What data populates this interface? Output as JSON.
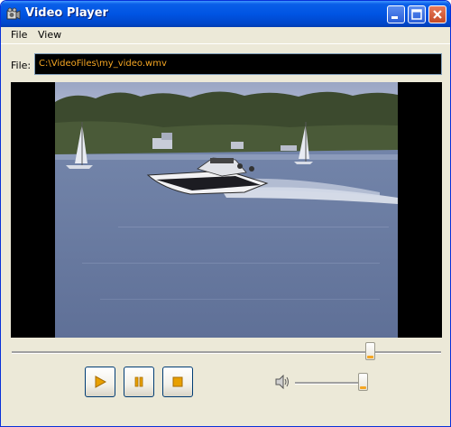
{
  "window": {
    "title": "Video Player"
  },
  "menu": {
    "items": [
      "File",
      "View"
    ]
  },
  "file": {
    "label": "File:",
    "path": "C:\\VideoFiles\\my_video.wmv"
  },
  "playback": {
    "position_fraction": 0.86
  },
  "volume": {
    "level_fraction": 0.95
  },
  "colors": {
    "titlebar": "#0054e3",
    "path_text": "#f5a623",
    "accent": "#f5a623"
  },
  "icons": [
    "app-icon",
    "minimize-icon",
    "maximize-icon",
    "close-icon",
    "play-icon",
    "pause-icon",
    "stop-icon",
    "speaker-icon"
  ]
}
